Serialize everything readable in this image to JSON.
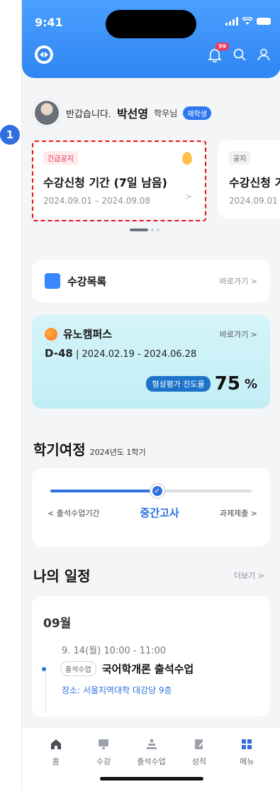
{
  "status_bar": {
    "time": "9:41"
  },
  "header": {
    "notification_count": "99"
  },
  "greeting": {
    "prefix": "반갑습니다.",
    "name": "박선영",
    "suffix": "학우님",
    "status_badge": "재학생"
  },
  "annotation_marker": "1",
  "notices": [
    {
      "tag": "긴급공지",
      "title": "수강신청 기간 (7일 남음)",
      "date": "2024.09.01 – 2024.09.08"
    },
    {
      "tag": "공지",
      "title": "수강신청 기",
      "date": "2024.09.01 -"
    }
  ],
  "courses_card": {
    "title": "수강목록",
    "link": "바로가기 >"
  },
  "uno_card": {
    "title": "유노캠퍼스",
    "link": "바로가기 >",
    "dday": "D-48",
    "period": "| 2024.02.19 - 2024.06.28",
    "progress_label": "형성평가 진도율",
    "progress_value": "75",
    "progress_unit": "%"
  },
  "semester": {
    "title": "학기여정",
    "subtitle": "2024년도 1학기",
    "progress": 0.53,
    "prev": "< 출석수업기간",
    "current": "중간고사",
    "next": "과제제출 >"
  },
  "schedule": {
    "title": "나의 일정",
    "more": "더보기 >",
    "month": "09월",
    "items": [
      {
        "time": "9. 14(월) 10:00 - 11:00",
        "chip": "출석수업",
        "title": "국어학개론 출석수업",
        "place": "장소: 서울지역대학 대강당 9층"
      }
    ]
  },
  "tabbar": [
    {
      "label": "홈",
      "icon": "home-icon"
    },
    {
      "label": "수강",
      "icon": "lecture-icon"
    },
    {
      "label": "출석수업",
      "icon": "attendance-icon"
    },
    {
      "label": "성적",
      "icon": "grade-icon"
    },
    {
      "label": "메뉴",
      "icon": "menu-grid-icon"
    }
  ],
  "colors": {
    "primary": "#2f6fe0",
    "header": "#3c93fb",
    "urgent": "#e0314d"
  }
}
